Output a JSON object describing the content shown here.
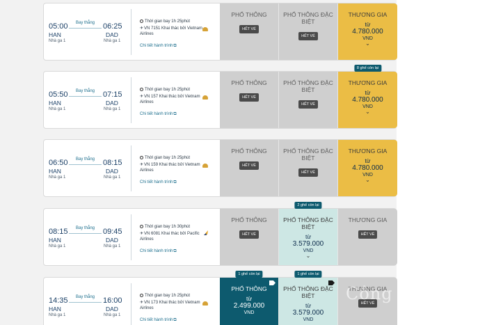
{
  "flights": [
    {
      "dep_time": "05:00",
      "dep_code": "HAN",
      "dep_terminal": "Nhà ga 1",
      "arr_time": "06:25",
      "arr_code": "DAD",
      "arr_terminal": "Nhà ga 1",
      "stop_label": "Bay thẳng",
      "duration": "Thời gian bay 1h 25phút",
      "operator": "VN 7151 Khai thác bởi Vietnam Airlines",
      "detail_link": "Chi tiết hành trình",
      "amenity_icon": "meal-icon",
      "fares": [
        {
          "name": "PHỔ THÔNG",
          "status": "HẾT VÉ",
          "style": "soldout"
        },
        {
          "name": "PHỔ THÔNG ĐẶC BIỆT",
          "status": "HẾT VÉ",
          "style": "soldout"
        },
        {
          "name": "THƯƠNG GIA",
          "from": "từ",
          "price": "4.780.000",
          "currency": "VND",
          "style": "gold"
        }
      ]
    },
    {
      "dep_time": "05:50",
      "dep_code": "HAN",
      "dep_terminal": "Nhà ga 1",
      "arr_time": "07:15",
      "arr_code": "DAD",
      "arr_terminal": "Nhà ga 1",
      "stop_label": "Bay thẳng",
      "duration": "Thời gian bay 1h 25phút",
      "operator": "VN 157 Khai thác bởi Vietnam Airlines",
      "detail_link": "Chi tiết hành trình",
      "amenity_icon": "meal-icon",
      "fares": [
        {
          "name": "PHỔ THÔNG",
          "status": "HẾT VÉ",
          "style": "soldout"
        },
        {
          "name": "PHỔ THÔNG ĐẶC BIỆT",
          "status": "HẾT VÉ",
          "style": "soldout"
        },
        {
          "name": "THƯƠNG GIA",
          "from": "từ",
          "price": "4.780.000",
          "currency": "VND",
          "style": "gold",
          "seat_badge": "8 ghế còn lại"
        }
      ]
    },
    {
      "dep_time": "06:50",
      "dep_code": "HAN",
      "dep_terminal": "Nhà ga 1",
      "arr_time": "08:15",
      "arr_code": "DAD",
      "arr_terminal": "Nhà ga 1",
      "stop_label": "Bay thẳng",
      "duration": "Thời gian bay 1h 25phút",
      "operator": "VN 159 Khai thác bởi Vietnam Airlines",
      "detail_link": "Chi tiết hành trình",
      "amenity_icon": "meal-icon",
      "fares": [
        {
          "name": "PHỔ THÔNG",
          "status": "HẾT VÉ",
          "style": "soldout"
        },
        {
          "name": "PHỔ THÔNG ĐẶC BIỆT",
          "status": "HẾT VÉ",
          "style": "soldout"
        },
        {
          "name": "THƯƠNG GIA",
          "from": "từ",
          "price": "4.780.000",
          "currency": "VND",
          "style": "gold"
        }
      ]
    },
    {
      "dep_time": "08:15",
      "dep_code": "HAN",
      "dep_terminal": "Nhà ga 1",
      "arr_time": "09:45",
      "arr_code": "DAD",
      "arr_terminal": "Nhà ga 1",
      "stop_label": "Bay thẳng",
      "duration": "Thời gian bay 1h 30phút",
      "operator": "VN 6081 Khai thác bởi Pacific Airlines",
      "detail_link": "Chi tiết hành trình",
      "amenity_icon": "pacific-airlines-logo-icon",
      "fares": [
        {
          "name": "PHỔ THÔNG",
          "status": "HẾT VÉ",
          "style": "soldout"
        },
        {
          "name": "PHỔ THÔNG ĐẶC BIỆT",
          "from": "từ",
          "price": "3.579.000",
          "currency": "VND",
          "style": "mint",
          "seat_badge": "2 ghế còn lại"
        },
        {
          "name": "THƯƠNG GIA",
          "status": "HẾT VÉ",
          "style": "soldout"
        }
      ]
    },
    {
      "dep_time": "14:35",
      "dep_code": "HAN",
      "dep_terminal": "Nhà ga 1",
      "arr_time": "16:00",
      "arr_code": "DAD",
      "arr_terminal": "Nhà ga 1",
      "stop_label": "Bay thẳng",
      "duration": "Thời gian bay 1h 25phút",
      "operator": "VN 173 Khai thác bởi Vietnam Airlines",
      "detail_link": "Chi tiết hành trình",
      "amenity_icon": "meal-icon",
      "fares": [
        {
          "name": "PHỔ THÔNG",
          "from": "từ",
          "price": "2.499.000",
          "currency": "VND",
          "style": "teal",
          "seat_badge": "1 ghế còn lại",
          "tag_icon": "tag-icon"
        },
        {
          "name": "PHỔ THÔNG ĐẶC BIỆT",
          "from": "từ",
          "price": "3.579.000",
          "currency": "VND",
          "style": "mint",
          "seat_badge": "1 ghế còn lại",
          "tag_icon": "tag-icon"
        },
        {
          "name": "THƯƠNG GIA",
          "status": "HẾT VÉ",
          "style": "soldout"
        }
      ]
    }
  ],
  "watermark": "Công Thương",
  "colors": {
    "gold": "#ebbd45",
    "mint": "#cde7e4",
    "teal": "#0d5a6e",
    "soldout": "#cfcfcf",
    "badge": "#0d5a6e"
  }
}
